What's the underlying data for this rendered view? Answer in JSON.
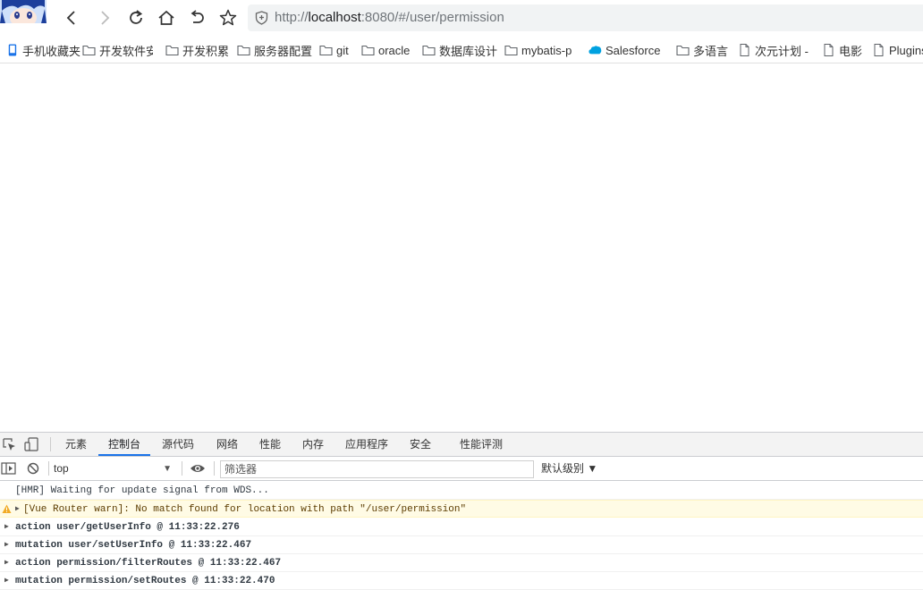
{
  "toolbar": {
    "address": {
      "scheme": "http://",
      "host": "localhost",
      "rest": ":8080/#/user/permission"
    }
  },
  "bookmarks": [
    {
      "label": "手机收藏夹",
      "icon": "mobile-bookmark-icon"
    },
    {
      "label": "开发软件安",
      "icon": "folder-icon"
    },
    {
      "label": "开发积累",
      "icon": "folder-icon"
    },
    {
      "label": "服务器配置",
      "icon": "folder-icon"
    },
    {
      "label": "git",
      "icon": "folder-icon"
    },
    {
      "label": "oracle",
      "icon": "folder-icon"
    },
    {
      "label": "数据库设计",
      "icon": "folder-icon"
    },
    {
      "label": "mybatis-p",
      "icon": "folder-icon"
    },
    {
      "label": "Salesforce",
      "icon": "salesforce-cloud-icon"
    },
    {
      "label": "多语言",
      "icon": "folder-icon"
    },
    {
      "label": "次元计划 -",
      "icon": "page-icon"
    },
    {
      "label": "电影",
      "icon": "page-icon"
    },
    {
      "label": "Plugins",
      "icon": "page-icon"
    }
  ],
  "devtools": {
    "tabs": [
      "元素",
      "控制台",
      "源代码",
      "网络",
      "性能",
      "内存",
      "应用程序",
      "安全",
      "性能评测"
    ],
    "active_tab": "控制台",
    "context": "top",
    "filter_placeholder": "筛选器",
    "level": "默认级别 ▼",
    "logs": [
      {
        "text": "[HMR] Waiting for update signal from WDS...",
        "kind": "info",
        "expandable": false
      },
      {
        "text": "[Vue Router warn]: No match found for location with path \"/user/permission\"",
        "kind": "warn",
        "expandable": true
      },
      {
        "text": "action user/getUserInfo @ 11:33:22.276",
        "kind": "log",
        "expandable": true
      },
      {
        "text": "mutation user/setUserInfo @ 11:33:22.467",
        "kind": "log",
        "expandable": true
      },
      {
        "text": "action permission/filterRoutes @ 11:33:22.467",
        "kind": "log",
        "expandable": true
      },
      {
        "text": "mutation permission/setRoutes @ 11:33:22.470",
        "kind": "log",
        "expandable": true
      }
    ]
  }
}
